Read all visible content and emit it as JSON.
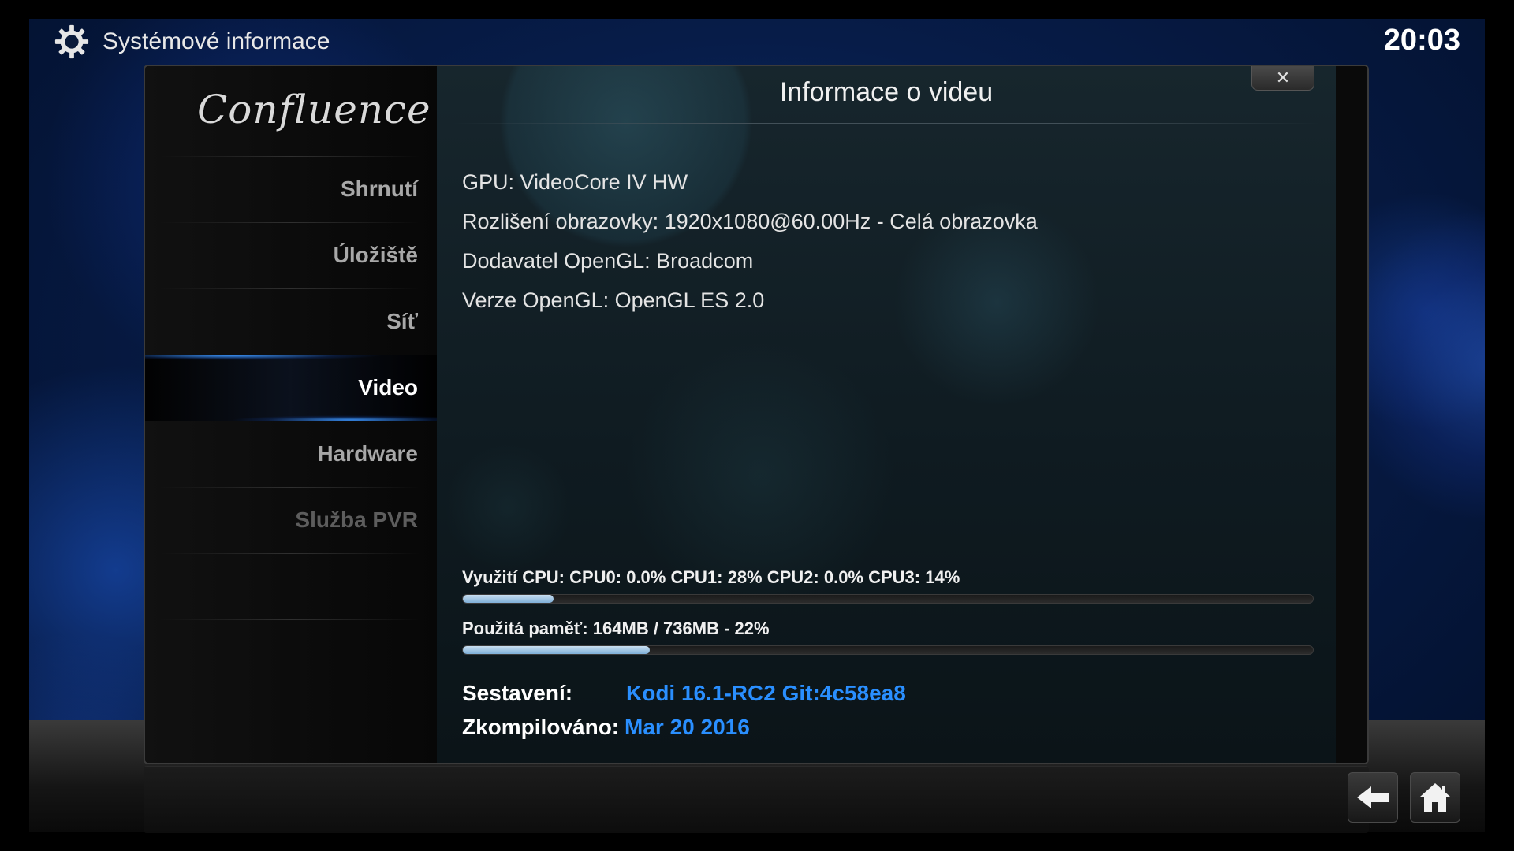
{
  "header": {
    "window_title": "Systémové informace",
    "clock": "20:03"
  },
  "icons": {
    "settings": "gear-icon",
    "back": "back-arrow-icon",
    "home": "home-icon",
    "close": "close-icon"
  },
  "sidebar": {
    "logo": "Confluence",
    "active_index": 3,
    "items": [
      {
        "label": "Shrnutí"
      },
      {
        "label": "Úložiště"
      },
      {
        "label": "Síť"
      },
      {
        "label": "Video"
      },
      {
        "label": "Hardware"
      },
      {
        "label": "Služba PVR"
      }
    ]
  },
  "dialog": {
    "title": "Informace o videu",
    "close_label": "✕",
    "info_lines": [
      "GPU: VideoCore IV HW",
      "Rozlišení obrazovky: 1920x1080@60.00Hz - Celá obrazovka",
      "Dodavatel OpenGL: Broadcom",
      "Verze OpenGL: OpenGL ES 2.0"
    ],
    "cpu_usage": {
      "label": "Využití CPU: CPU0: 0.0% CPU1:  28% CPU2: 0.0% CPU3:  14%",
      "bar_fraction": 0.107
    },
    "memory_usage": {
      "label": "Použitá paměť: 164MB / 736MB - 22%",
      "bar_fraction": 0.22
    },
    "build": {
      "label": "Sestavení:",
      "value": "Kodi 16.1-RC2 Git:4c58ea8"
    },
    "compiled": {
      "label": "Zkompilováno:",
      "value": "Mar 20 2016"
    }
  },
  "colors": {
    "accent_blue": "#2a8fff",
    "bar_fill": "#a8cbe6"
  }
}
